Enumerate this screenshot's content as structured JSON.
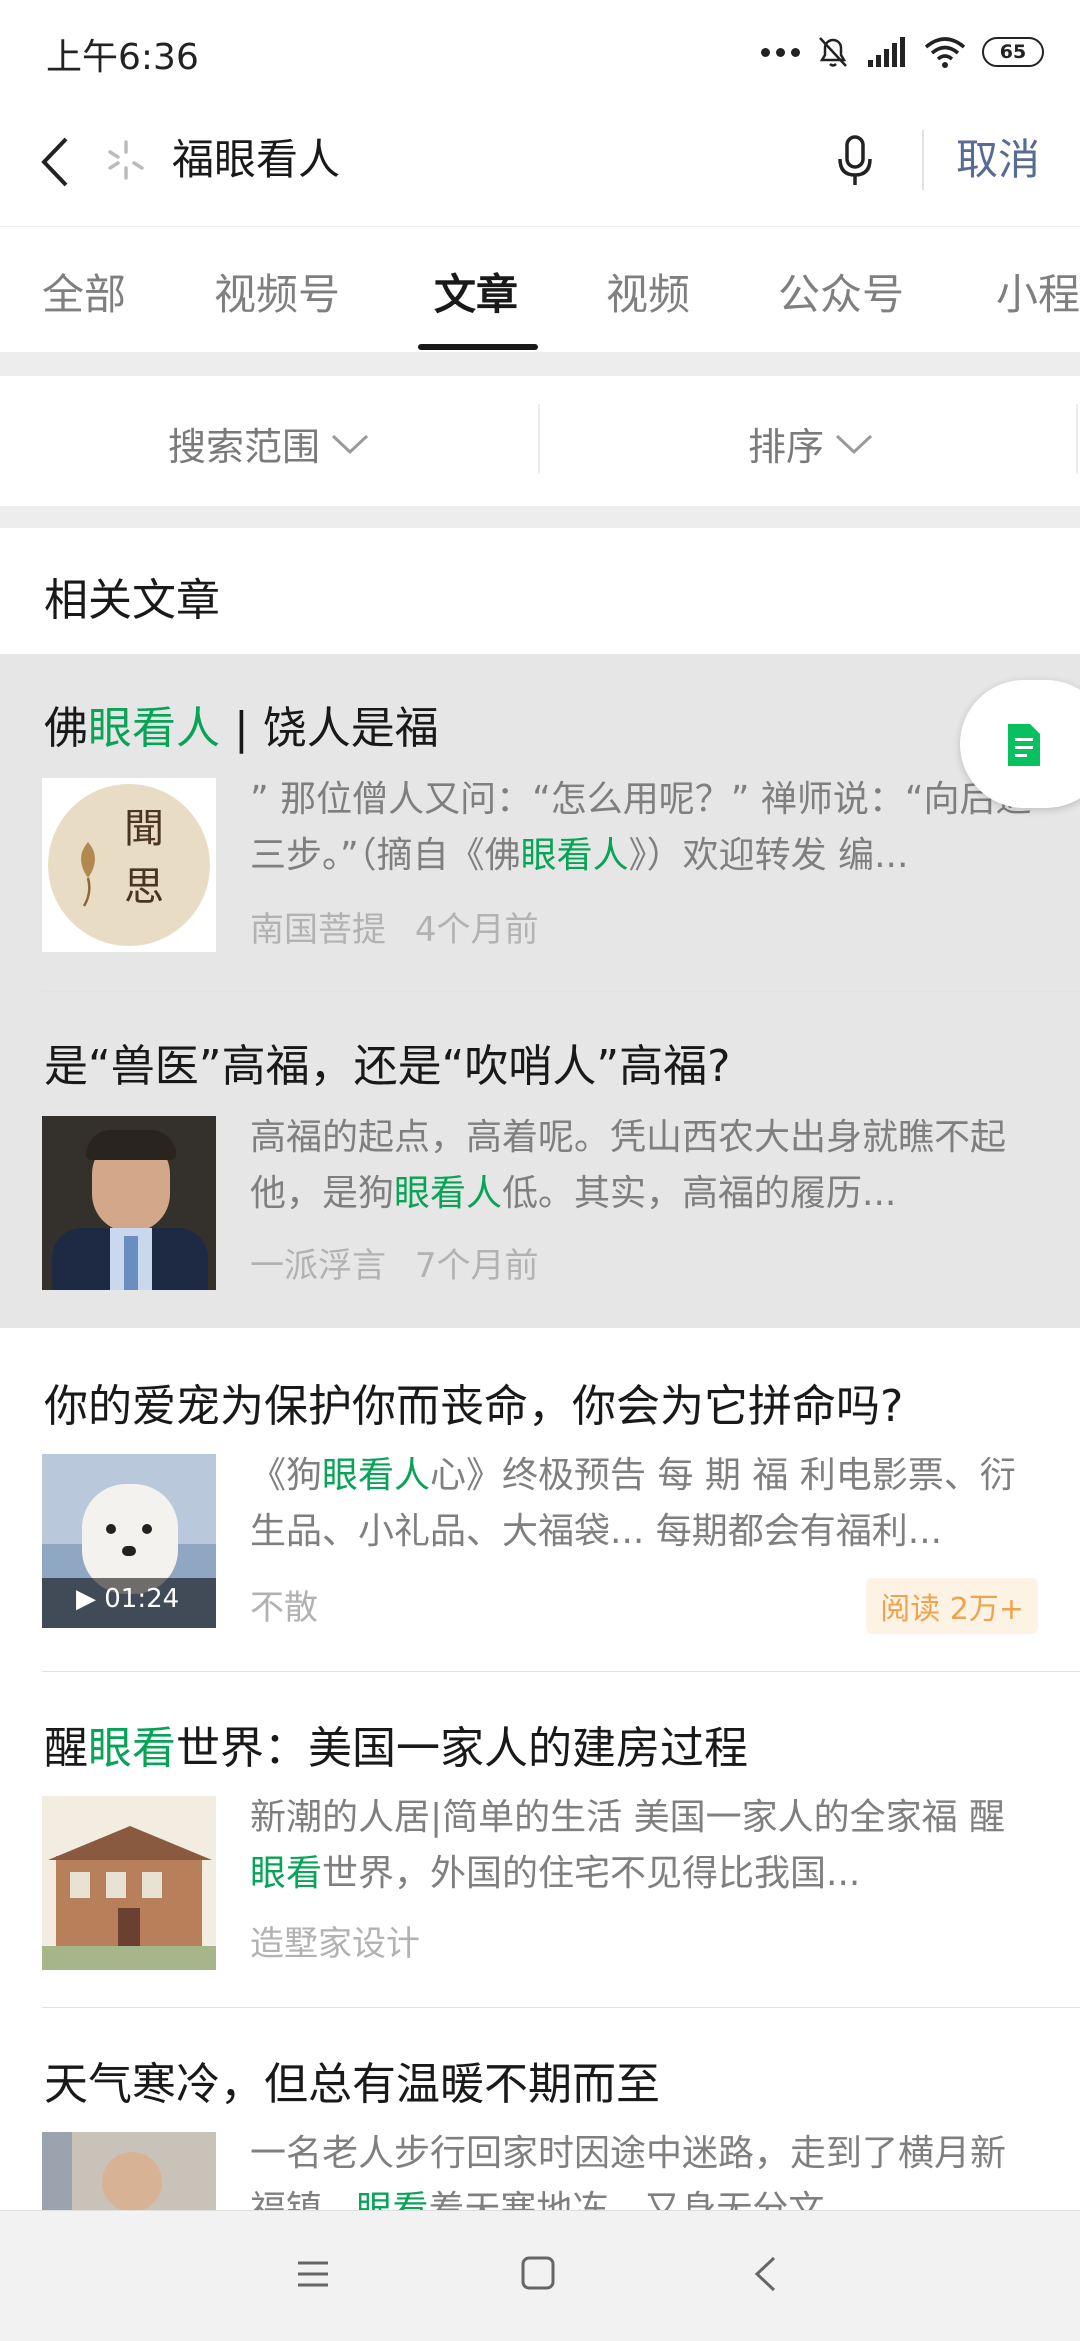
{
  "status_bar": {
    "time": "上午6:36",
    "battery": "65"
  },
  "search": {
    "query": "福眼看人",
    "cancel_label": "取消"
  },
  "tabs": [
    {
      "label": "全部"
    },
    {
      "label": "视频号"
    },
    {
      "label": "文章",
      "active": true
    },
    {
      "label": "视频"
    },
    {
      "label": "公众号"
    },
    {
      "label": "小程"
    }
  ],
  "filters": {
    "scope_label": "搜索范围",
    "sort_label": "排序"
  },
  "section": {
    "title": "相关文章"
  },
  "articles": [
    {
      "title_parts": [
        {
          "text": "佛"
        },
        {
          "text": "眼看人",
          "kw": true
        },
        {
          "text": " | 饶人是福"
        }
      ],
      "snippet_parts": [
        {
          "text": "” 那位僧人又问：“怎么用呢？” 禅师说：“向后退三步。”（摘自《佛"
        },
        {
          "text": "眼看人",
          "kw": true
        },
        {
          "text": "》）欢迎转发 编..."
        }
      ],
      "source": "南国菩提",
      "time": "4个月前",
      "thumb_text": "聞思"
    },
    {
      "title_parts": [
        {
          "text": "是“兽医”高福，还是“吹哨人”高福?"
        }
      ],
      "snippet_parts": [
        {
          "text": "高福的起点，高着呢。凭山西农大出身就瞧不起他，是狗"
        },
        {
          "text": "眼看人",
          "kw": true
        },
        {
          "text": "低。其实，高福的履历..."
        }
      ],
      "source": "一派浮言",
      "time": "7个月前"
    },
    {
      "title_parts": [
        {
          "text": "你的爱宠为保护你而丧命，你会为它拼命吗?"
        }
      ],
      "snippet_parts": [
        {
          "text": "《狗"
        },
        {
          "text": "眼看人",
          "kw": true
        },
        {
          "text": "心》终极预告 每 期 福 利电影票、衍生品、小礼品、大福袋... 每期都会有福利..."
        }
      ],
      "source": "不散",
      "video_duration": "▶ 01:24",
      "read_badge": "阅读 2万+"
    },
    {
      "title_parts": [
        {
          "text": "醒"
        },
        {
          "text": "眼看",
          "kw": true
        },
        {
          "text": "世界：美国一家人的建房过程"
        }
      ],
      "snippet_parts": [
        {
          "text": "新潮的人居|简单的生活 美国一家人的全家福 醒"
        },
        {
          "text": "眼看",
          "kw": true
        },
        {
          "text": "世界，外国的住宅不见得比我国..."
        }
      ],
      "source": "造墅家设计"
    },
    {
      "title_parts": [
        {
          "text": "天气寒冷，但总有温暖不期而至"
        }
      ],
      "snippet_parts": [
        {
          "text": "一名老人步行回家时因途中迷路，走到了横月新福镇..."
        },
        {
          "text": "眼看",
          "kw": true
        },
        {
          "text": "着天寒地冻，又身无分文..."
        }
      ]
    }
  ],
  "icons": {
    "back": "back-arrow-icon",
    "loading": "loading-spinner-icon",
    "mic": "microphone-icon",
    "chevron": "chevron-down-icon",
    "float": "document-icon",
    "nav_menu": "menu-icon",
    "nav_home": "home-square-icon",
    "nav_back": "back-triangle-icon"
  },
  "colors": {
    "keyword": "#07a356",
    "link": "#576b95",
    "badge_text": "#f0a24c"
  }
}
